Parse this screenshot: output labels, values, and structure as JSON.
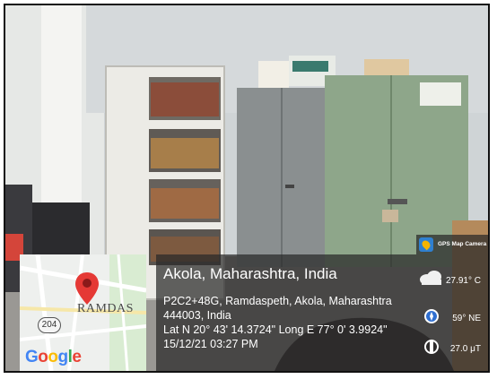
{
  "location": {
    "title": "Akola, Maharashtra, India",
    "address_line1": "P2C2+48G, Ramdaspeth, Akola, Maharashtra",
    "address_line2": "444003, India",
    "coordinates": "Lat N 20° 43' 14.3724\" Long E 77° 0' 3.9924\"",
    "datetime": "15/12/21 03:27 PM"
  },
  "weather": {
    "temperature": "27.91° C",
    "wind": "59° NE",
    "magnetic": "27.0 μT"
  },
  "map": {
    "label": "RAMDAS",
    "road_number": "204",
    "provider": "Google"
  },
  "app": {
    "name": "GPS Map Camera"
  },
  "colors": {
    "overlay": "#282828",
    "pin": "#e53935",
    "cabinet_green": "#8ea68a",
    "cabinet_grey": "#8a8f90"
  }
}
